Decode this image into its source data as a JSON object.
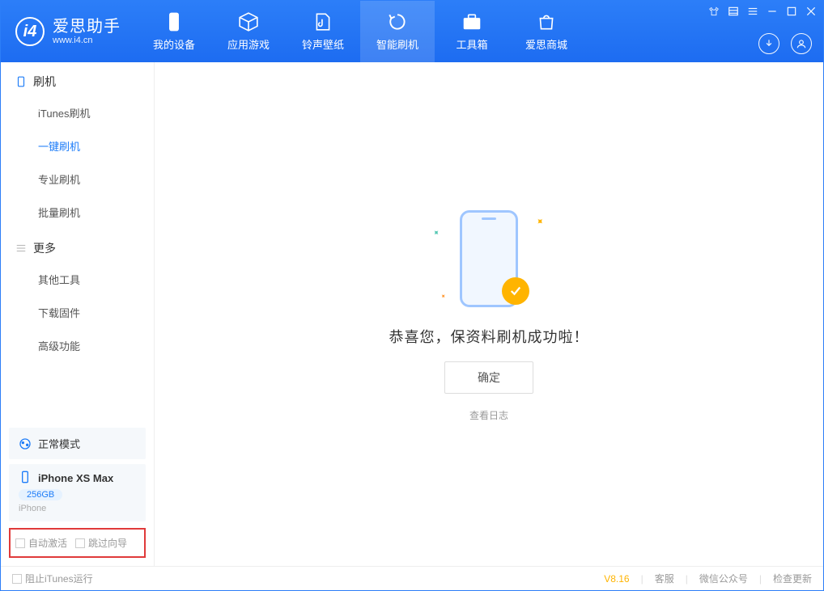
{
  "app": {
    "title": "爱思助手",
    "subtitle": "www.i4.cn"
  },
  "nav": {
    "items": [
      {
        "label": "我的设备"
      },
      {
        "label": "应用游戏"
      },
      {
        "label": "铃声壁纸"
      },
      {
        "label": "智能刷机"
      },
      {
        "label": "工具箱"
      },
      {
        "label": "爱思商城"
      }
    ]
  },
  "sidebar": {
    "section1": {
      "title": "刷机",
      "items": [
        {
          "label": "iTunes刷机"
        },
        {
          "label": "一键刷机"
        },
        {
          "label": "专业刷机"
        },
        {
          "label": "批量刷机"
        }
      ]
    },
    "section2": {
      "title": "更多",
      "items": [
        {
          "label": "其他工具"
        },
        {
          "label": "下载固件"
        },
        {
          "label": "高级功能"
        }
      ]
    },
    "mode_label": "正常模式",
    "device": {
      "name": "iPhone XS Max",
      "storage": "256GB",
      "type": "iPhone"
    },
    "options": {
      "auto_activate": "自动激活",
      "skip_guide": "跳过向导"
    }
  },
  "main": {
    "success_text": "恭喜您，保资料刷机成功啦！",
    "ok_button": "确定",
    "view_log": "查看日志"
  },
  "footer": {
    "block_itunes": "阻止iTunes运行",
    "version": "V8.16",
    "support": "客服",
    "wechat": "微信公众号",
    "update": "检查更新"
  }
}
